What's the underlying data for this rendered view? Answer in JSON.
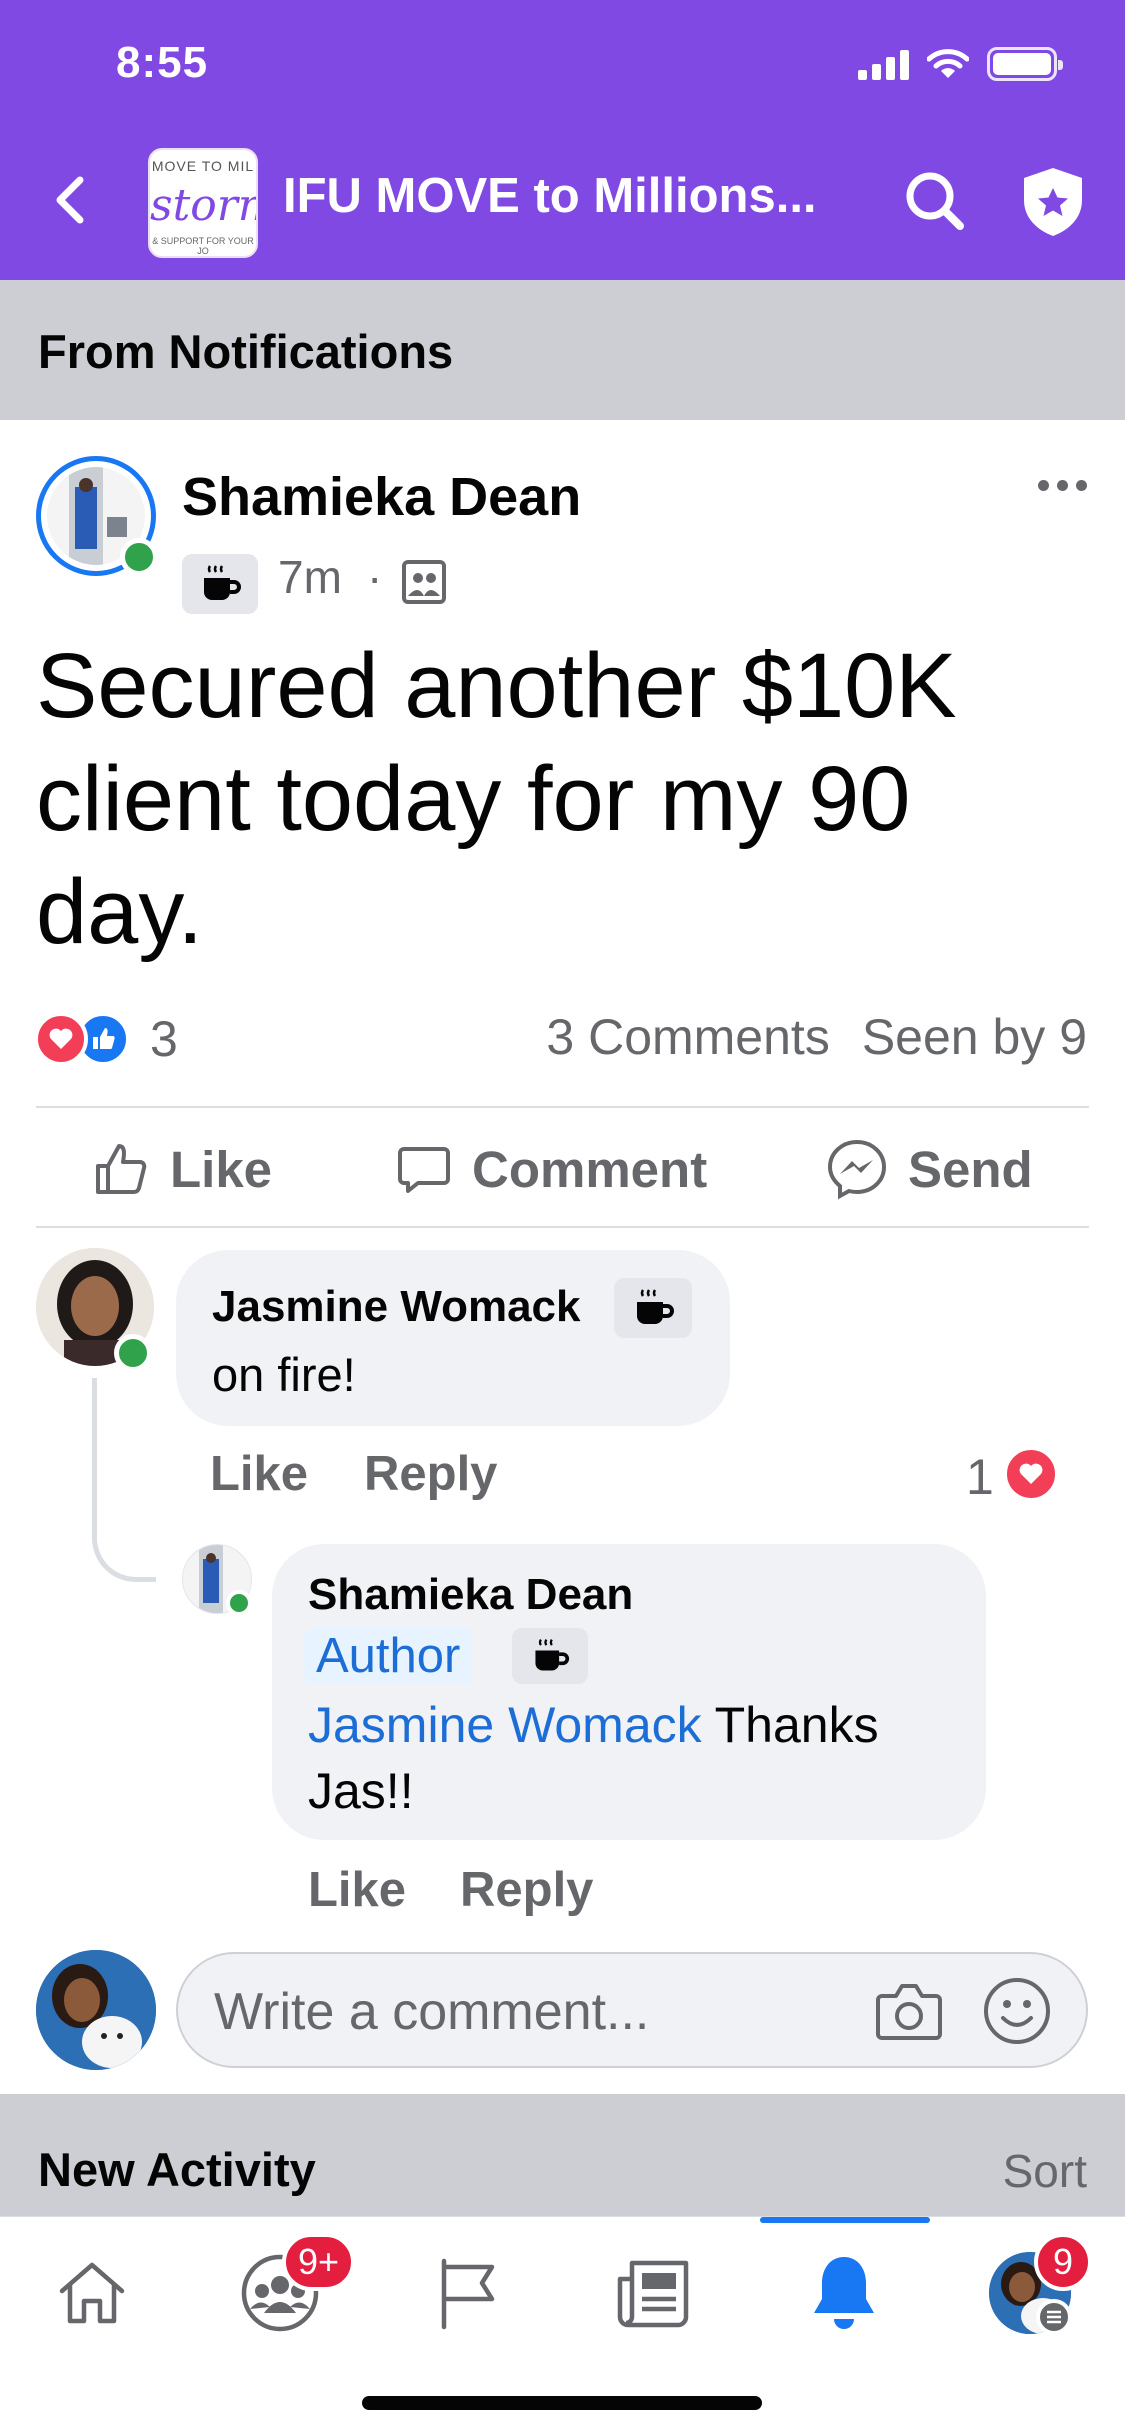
{
  "status_bar": {
    "time": "8:55"
  },
  "header": {
    "group_title": "IFU MOVE to Millions...",
    "logo_text": {
      "top": "MOVE TO MIL",
      "script": "storm",
      "bottom": "& SUPPORT FOR YOUR JO"
    },
    "accent_color": "#8149e4"
  },
  "source_bar": {
    "label": "From Notifications"
  },
  "post": {
    "author": "Shamieka Dean",
    "badge_icon": "coffee-cup-icon",
    "time": "7m",
    "separator": "·",
    "audience_icon": "group-audience-icon",
    "text": "Secured another $10K client today for my 90 day.",
    "reaction_types": [
      "love",
      "like"
    ],
    "reaction_count": "3",
    "comments_count": "3 Comments",
    "seen_by": "Seen by 9"
  },
  "actions": {
    "like": "Like",
    "comment": "Comment",
    "send": "Send"
  },
  "comments": [
    {
      "author": "Jasmine Womack",
      "badge_icon": "coffee-cup-icon",
      "text": "on fire!",
      "like_label": "Like",
      "reply_label": "Reply",
      "reaction_count": "1",
      "reaction_type": "love"
    },
    {
      "author": "Shamieka Dean",
      "author_chip": "Author",
      "badge_icon": "coffee-cup-icon",
      "mention": "Jasmine Womack",
      "text_rest": " Thanks",
      "text_line2": "Jas!!",
      "like_label": "Like",
      "reply_label": "Reply"
    }
  ],
  "composer": {
    "placeholder": "Write a comment..."
  },
  "new_activity": {
    "title": "New Activity",
    "sort_label": "Sort"
  },
  "tabbar": {
    "tabs": [
      "home",
      "groups",
      "pages",
      "news",
      "notifications",
      "menu"
    ],
    "active_tab": "notifications",
    "groups_badge": "9+",
    "menu_badge": "9",
    "accent_color": "#1877f2",
    "badge_color": "#e41e3f"
  }
}
